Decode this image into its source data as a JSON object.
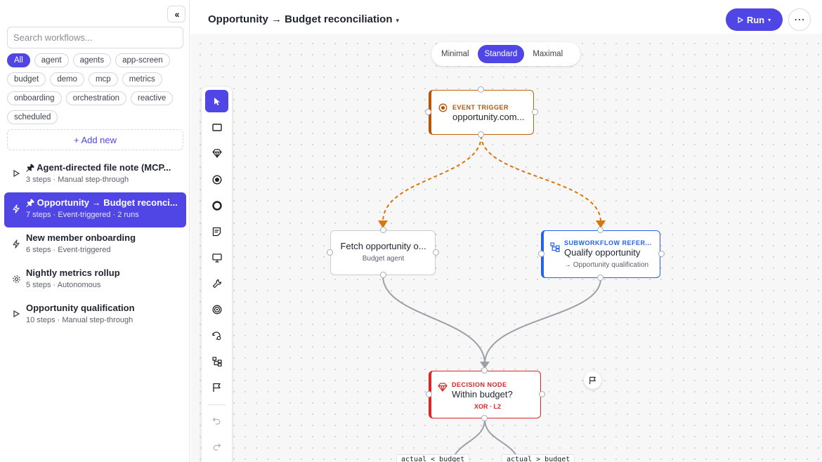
{
  "sidebar": {
    "collapse_icon": "double-chevron-left-icon",
    "search": {
      "placeholder": "Search workflows...",
      "value": ""
    },
    "tags": [
      "All",
      "agent",
      "agents",
      "app-screen",
      "budget",
      "demo",
      "mcp",
      "metrics",
      "onboarding",
      "orchestration",
      "reactive",
      "scheduled"
    ],
    "active_tag": "All",
    "add_new_label": "+ Add new",
    "workflows": [
      {
        "title": "Agent-directed file note (MCP...",
        "pinned": true,
        "meta": "3 steps · Manual step-through",
        "icon": "play-icon"
      },
      {
        "title": "Opportunity → Budget reconci...",
        "pinned": true,
        "meta": "7 steps · Event-triggered · 2 runs",
        "icon": "bolt-icon",
        "selected": true
      },
      {
        "title": "New member onboarding",
        "pinned": false,
        "meta": "6 steps · Event-triggered",
        "icon": "bolt-icon"
      },
      {
        "title": "Nightly metrics rollup",
        "pinned": false,
        "meta": "5 steps · Autonomous",
        "icon": "gear-icon"
      },
      {
        "title": "Opportunity qualification",
        "pinned": false,
        "meta": "10 steps · Manual step-through",
        "icon": "play-icon"
      }
    ]
  },
  "header": {
    "title": "Opportunity → Budget reconciliation",
    "title_caret": "▾",
    "run_label": "Run",
    "run_caret": "▾",
    "more_label": "⋯"
  },
  "view_modes": {
    "options": [
      "Minimal",
      "Standard",
      "Maximal"
    ],
    "active": "Standard"
  },
  "toolbar": {
    "tools": [
      "pointer-icon",
      "rectangle-icon",
      "diamond-icon",
      "radio-filled-icon",
      "circle-icon",
      "note-icon",
      "monitor-icon",
      "wrench-icon",
      "target-icon",
      "history-gear-icon",
      "subworkflow-icon",
      "flag-icon",
      "undo-icon",
      "redo-icon"
    ],
    "active_tool": "pointer-icon"
  },
  "nodes": {
    "trigger": {
      "kind": "EVENT TRIGGER",
      "title": "opportunity.com..."
    },
    "fetch": {
      "title": "Fetch opportunity o...",
      "subtitle": "Budget agent"
    },
    "subworkflow": {
      "kind": "SUBWORKFLOW REFER...",
      "title": "Qualify opportunity",
      "subtitle": "→ Opportunity qualification"
    },
    "decision": {
      "kind": "DECISION NODE",
      "title": "Within budget?",
      "subtitle": "XOR · L2"
    }
  },
  "edge_labels": [
    "actual < budget",
    "actual > budget"
  ],
  "colors": {
    "accent": "#4f46e5",
    "trigger": "#b4560a",
    "subworkflow": "#2563eb",
    "decision": "#dc2626",
    "edge": "#9ca0a8",
    "trigger_edge": "#d97706"
  }
}
